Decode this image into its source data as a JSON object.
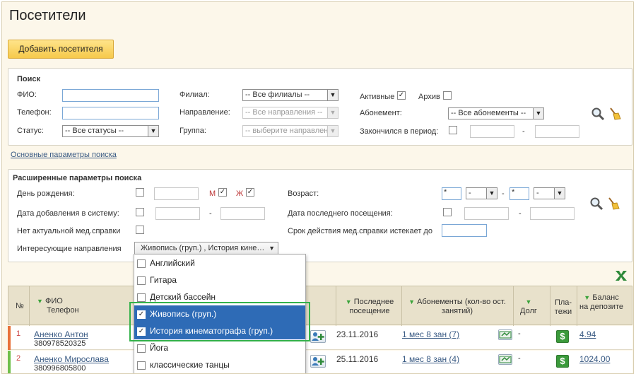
{
  "page": {
    "title": "Посетители"
  },
  "toolbar": {
    "add_label": "Добавить посетителя"
  },
  "search": {
    "title": "Поиск",
    "fio_label": "ФИО:",
    "phone_label": "Телефон:",
    "status_label": "Статус:",
    "status_value": "-- Все статусы --",
    "branch_label": "Филиал:",
    "branch_value": "-- Все филиалы --",
    "direction_label": "Направление:",
    "direction_value": "-- Все направления --",
    "group_label": "Группа:",
    "group_value": "-- выберите направлен",
    "active_label": "Активные",
    "active_checked": "✓",
    "archive_label": "Архив",
    "subscription_label": "Абонемент:",
    "subscription_value": "-- Все абонементы --",
    "ended_label": "Закончился в период:",
    "range_dash": "-",
    "basic_link": "Основные параметры поиска"
  },
  "advanced": {
    "title": "Расширенные параметры поиска",
    "birthday_label": "День рождения:",
    "m_label": "М",
    "m_checked": "✓",
    "f_label": "Ж",
    "f_checked": "✓",
    "age_label": "Возраст:",
    "age_from": "*",
    "age_to": "*",
    "age_sel_1": "-",
    "age_sel_2": "-",
    "dash": "-",
    "added_label": "Дата добавления в систему:",
    "last_visit_label": "Дата последнего посещения:",
    "no_cert_label": "Нет актуальной мед.справки",
    "cert_expires_label": "Срок действия мед.справки истекает до",
    "interests_label": "Интересующие направления",
    "interests_value": "Живопись (груп.) , История кине…"
  },
  "dropdown": {
    "items": [
      {
        "label": "Английский",
        "checked": ""
      },
      {
        "label": "Гитара",
        "checked": ""
      },
      {
        "label": "Детский бассейн",
        "checked": ""
      },
      {
        "label": "Живопись (груп.)",
        "checked": "✓"
      },
      {
        "label": "История кинематографа (груп.)",
        "checked": "✓"
      },
      {
        "label": "Йога",
        "checked": ""
      },
      {
        "label": "классические танцы",
        "checked": ""
      }
    ]
  },
  "table": {
    "col_num": "№",
    "col_fio": "ФИО",
    "col_phone": "Телефон",
    "col_last_visit": "Последнее посещение",
    "col_subscriptions": "Абонементы (кол-во ост. занятий)",
    "col_debt": "Долг",
    "col_payments": "Пла-тежи",
    "col_balance": "Баланс на депозите",
    "rows": [
      {
        "num": "1",
        "name": "Аненко Антон",
        "phone": "380978520325",
        "last_visit": "23.11.2016",
        "subscription": "1 мес 8 зан (7)",
        "debt": "-",
        "balance": "4.94",
        "accent": "#e8713a"
      },
      {
        "num": "2",
        "name": "Аненко Мирослава",
        "phone": "380996805800",
        "last_visit": "25.11.2016",
        "subscription": "1 мес 8 зан (4)",
        "debt": "-",
        "balance": "1024.00",
        "accent": "#6fbf4a"
      }
    ]
  },
  "colors": {
    "accent_yellow": "#f6c94b",
    "selection_blue": "#2e6bb6",
    "highlight_green": "#34b24a"
  }
}
